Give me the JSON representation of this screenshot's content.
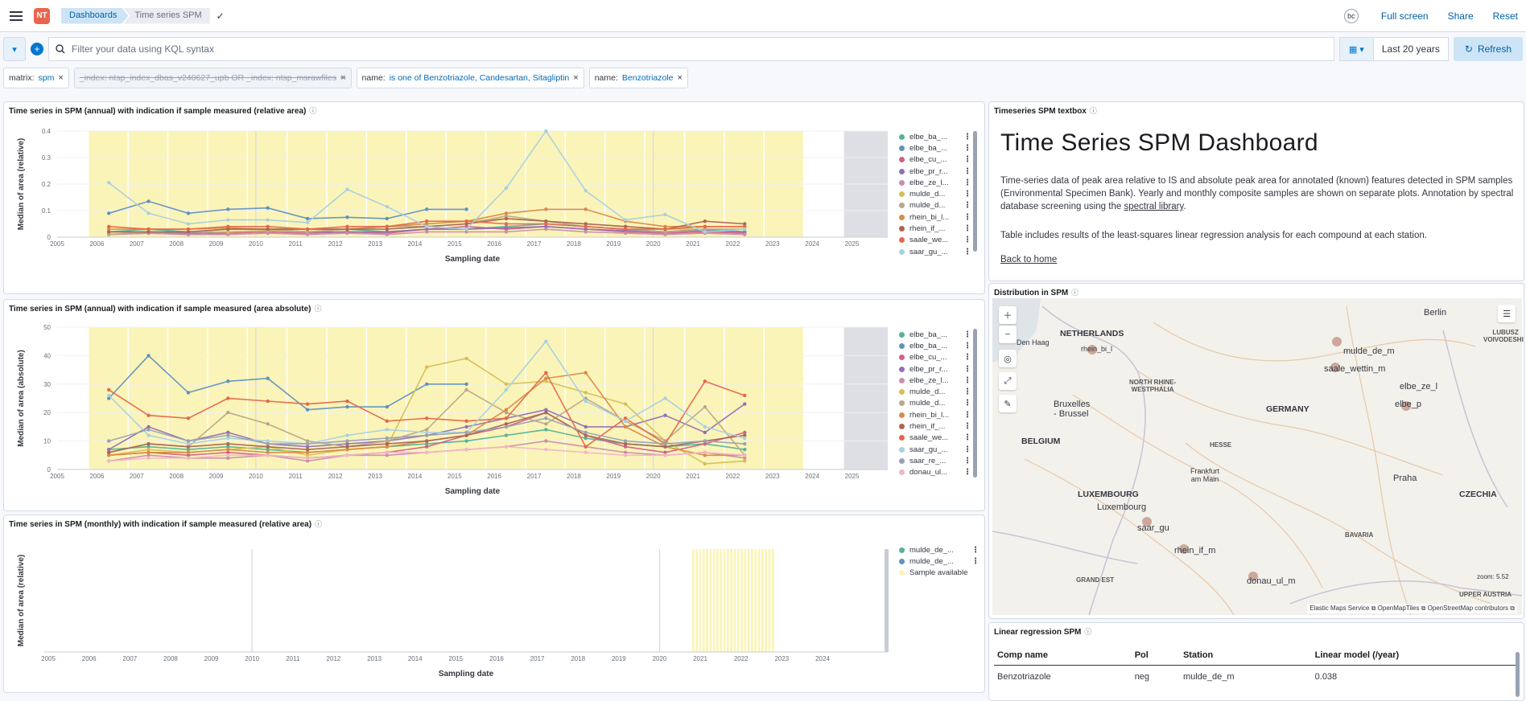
{
  "topbar": {
    "logo": "NT",
    "breadcrumb1": "Dashboards",
    "breadcrumb2": "Time series SPM",
    "avatar": "bc",
    "full_screen": "Full screen",
    "share": "Share",
    "reset": "Reset"
  },
  "query": {
    "placeholder": "Filter your data using KQL syntax",
    "time_range": "Last 20 years",
    "refresh": "Refresh"
  },
  "filters": [
    {
      "key": "matrix:",
      "value": "spm",
      "disabled": false
    },
    {
      "key": "_index: ntsp_index_dbas_v240627_upb OR _index: ntsp_msrawfiles",
      "value": "",
      "disabled": true
    },
    {
      "key": "name:",
      "value": "is one of Benzotriazole, Candesartan, Sitagliptin",
      "disabled": false
    },
    {
      "key": "name:",
      "value": "Benzotriazole",
      "disabled": false
    }
  ],
  "panel1": {
    "title": "Time series in SPM (annual) with indication if sample measured (relative area)",
    "legend": [
      "elbe_ba_...",
      "elbe_ba_...",
      "elbe_cu_...",
      "elbe_pr_r...",
      "elbe_ze_l...",
      "mulde_d...",
      "mulde_d...",
      "rhein_bi_l...",
      "rhein_if_...",
      "saale_we...",
      "saar_gu_..."
    ]
  },
  "panel2": {
    "title": "Time series in SPM (annual) with indication if sample measured (area absolute)",
    "legend": [
      "elbe_ba_...",
      "elbe_ba_...",
      "elbe_cu_...",
      "elbe_pr_r...",
      "elbe_ze_l...",
      "mulde_d...",
      "mulde_d...",
      "rhein_bi_l...",
      "rhein_if_...",
      "saale_we...",
      "saar_gu_...",
      "saar_re_...",
      "donau_ul..."
    ]
  },
  "panel3": {
    "title": "Time series in SPM (monthly) with indication if sample measured (relative area)",
    "legend": [
      "mulde_de_...",
      "mulde_de_...",
      "Sample available"
    ]
  },
  "textbox": {
    "title": "Timeseries SPM textbox",
    "heading": "Time Series SPM Dashboard",
    "p1a": "Time-series data of peak area relative to IS and absolute peak area for annotated (known) features detected in SPM samples (Environmental Specimen Bank). Yearly and monthly composite samples are shown on separate plots. Annotation by spectral database screening using the ",
    "p1link": "spectral library",
    "p1b": ".",
    "p2": "Table includes results of the least-squares linear regression analysis for each compound at each station.",
    "back": "Back to home"
  },
  "map": {
    "title": "Distribution in SPM",
    "zoom": "zoom: 5.52",
    "attribution": [
      "Elastic Maps Service",
      "OpenMapTiles",
      "OpenStreetMap contributors"
    ],
    "labels": {
      "netherlands": "NETHERLANDS",
      "denhaag": "Den Haag",
      "belgium": "BELGIUM",
      "bruxelles": "Bruxelles\n- Brussel",
      "luxembourg_c": "LUXEMBOURG",
      "luxembourg": "Luxembourg",
      "germany": "GERMANY",
      "nrw": "NORTH RHINE-\nWESTPHALIA",
      "hesse": "HESSE",
      "frankfurt": "Frankfurt\nam Main",
      "bavaria": "BAVARIA",
      "czechia": "CZECHIA",
      "praha": "Praha",
      "berlin": "Berlin",
      "lubusz": "LUBUSZ\nVOIVODESHIP",
      "upper_austria": "UPPER AUSTRIA",
      "grand_est": "GRAND EST"
    },
    "stations": [
      "rhein_bi_l",
      "mulde_de_m",
      "saale_wettin_m",
      "elbe_ze_l",
      "elbe_p",
      "saar_gu",
      "rhein_if_m",
      "donau_ul_m"
    ]
  },
  "regression": {
    "title": "Linear regression SPM",
    "headers": [
      "Comp name",
      "Pol",
      "Station",
      "Linear model (/year)"
    ],
    "rows": [
      [
        "Benzotriazole",
        "neg",
        "mulde_de_m",
        "0.038"
      ]
    ]
  },
  "chart_data": [
    {
      "type": "line",
      "title": "Time series in SPM (annual) with indication if sample measured (relative area)",
      "xlabel": "Sampling date",
      "ylabel": "Median of area (relative)",
      "xlim": [
        2005,
        2025.9
      ],
      "ylim": [
        0,
        0.4
      ],
      "x_ticks": [
        "2005",
        "2006",
        "2007",
        "2008",
        "2009",
        "2010",
        "2011",
        "2012",
        "2013",
        "2014",
        "2015",
        "2016",
        "2017",
        "2018",
        "2019",
        "2020",
        "2021",
        "2022",
        "2023",
        "2024",
        "2025"
      ],
      "y_ticks": [
        0,
        0.1,
        0.2,
        0.3,
        0.4
      ],
      "sample_available_range": [
        2005.8,
        2022.9
      ],
      "no_data_range": [
        2024.8,
        2025.9
      ],
      "x": [
        2006.3,
        2007.3,
        2008.3,
        2009.3,
        2010.3,
        2011.3,
        2012.3,
        2013.3,
        2014.3,
        2015.3,
        2016.3,
        2017.3,
        2018.3,
        2019.3,
        2020.3,
        2021.3,
        2022.3
      ],
      "series": [
        {
          "name": "elbe_ba_...",
          "color": "#54b399",
          "values": [
            0.02,
            0.03,
            0.02,
            0.03,
            0.03,
            0.02,
            0.03,
            0.02,
            0.03,
            0.03,
            0.04,
            0.05,
            0.04,
            0.03,
            0.02,
            0.03,
            0.02
          ]
        },
        {
          "name": "elbe_ba_...",
          "color": "#6092c0",
          "values": [
            0.09,
            0.135,
            0.09,
            0.105,
            0.11,
            0.07,
            0.075,
            0.07,
            0.105,
            0.105,
            null,
            null,
            null,
            null,
            null,
            null,
            null
          ]
        },
        {
          "name": "elbe_cu_...",
          "color": "#d36086",
          "values": [
            0.01,
            0.015,
            0.01,
            0.015,
            0.02,
            0.015,
            0.02,
            0.015,
            0.03,
            0.04,
            0.03,
            0.04,
            0.03,
            0.02,
            0.015,
            0.02,
            0.015
          ]
        },
        {
          "name": "elbe_pr_r...",
          "color": "#9170b8",
          "values": [
            0.02,
            0.02,
            0.015,
            0.02,
            0.025,
            0.02,
            0.02,
            0.02,
            0.03,
            0.03,
            0.035,
            0.04,
            0.03,
            0.025,
            0.02,
            0.025,
            0.02
          ]
        },
        {
          "name": "elbe_ze_l...",
          "color": "#ca8eae",
          "values": [
            0.01,
            0.015,
            0.01,
            0.01,
            0.015,
            0.01,
            0.015,
            0.01,
            0.02,
            0.02,
            0.02,
            0.03,
            0.02,
            0.015,
            0.01,
            0.015,
            0.01
          ]
        },
        {
          "name": "mulde_d...",
          "color": "#d6bf57",
          "values": [
            0.02,
            0.02,
            0.02,
            0.02,
            0.025,
            0.02,
            0.03,
            0.04,
            0.05,
            0.06,
            0.07,
            0.06,
            0.05,
            0.04,
            0.03,
            0.03,
            0.03
          ]
        },
        {
          "name": "mulde_d...",
          "color": "#b9a888",
          "values": [
            0.01,
            0.02,
            0.02,
            0.03,
            0.03,
            0.02,
            0.03,
            0.04,
            0.04,
            0.05,
            0.08,
            0.06,
            0.04,
            0.03,
            0.02,
            0.03,
            0.03
          ]
        },
        {
          "name": "rhein_bi_l...",
          "color": "#da8b45",
          "values": [
            0.03,
            0.03,
            0.03,
            0.035,
            0.03,
            0.03,
            0.03,
            0.04,
            0.05,
            0.06,
            0.09,
            0.105,
            0.105,
            0.06,
            0.04,
            0.04,
            0.04
          ]
        },
        {
          "name": "rhein_if_...",
          "color": "#aa6556",
          "values": [
            0.02,
            0.02,
            0.02,
            0.03,
            0.03,
            0.03,
            0.03,
            0.03,
            0.04,
            0.05,
            0.07,
            0.06,
            0.05,
            0.04,
            0.03,
            0.06,
            0.05
          ]
        },
        {
          "name": "saale_we...",
          "color": "#e7664c",
          "values": [
            0.04,
            0.03,
            0.03,
            0.04,
            0.04,
            0.03,
            0.04,
            0.04,
            0.06,
            0.06,
            0.05,
            0.05,
            0.04,
            0.03,
            0.03,
            0.04,
            0.04
          ]
        },
        {
          "name": "saar_gu_...",
          "color": "#a8d0e0",
          "values": [
            0.205,
            0.09,
            0.05,
            0.065,
            0.065,
            0.055,
            0.18,
            0.115,
            0.04,
            0.03,
            0.185,
            0.4,
            0.175,
            0.065,
            0.085,
            0.02,
            0.03
          ]
        }
      ]
    },
    {
      "type": "line",
      "title": "Time series in SPM (annual) with indication if sample measured (area absolute)",
      "xlabel": "Sampling date",
      "ylabel": "Median of area (absolute)",
      "xlim": [
        2005,
        2025.9
      ],
      "ylim": [
        0,
        50
      ],
      "x_ticks": [
        "2005",
        "2006",
        "2007",
        "2008",
        "2009",
        "2010",
        "2011",
        "2012",
        "2013",
        "2014",
        "2015",
        "2016",
        "2017",
        "2018",
        "2019",
        "2020",
        "2021",
        "2022",
        "2023",
        "2024",
        "2025"
      ],
      "y_ticks": [
        0,
        10,
        20,
        30,
        40,
        50
      ],
      "sample_available_range": [
        2005.8,
        2022.9
      ],
      "no_data_range": [
        2024.8,
        2025.9
      ],
      "x": [
        2006.3,
        2007.3,
        2008.3,
        2009.3,
        2010.3,
        2011.3,
        2012.3,
        2013.3,
        2014.3,
        2015.3,
        2016.3,
        2017.3,
        2018.3,
        2019.3,
        2020.3,
        2021.3,
        2022.3
      ],
      "series": [
        {
          "name": "elbe_ba_...",
          "color": "#54b399",
          "values": [
            7,
            8,
            7,
            8,
            7,
            6,
            7,
            8,
            9,
            10,
            12,
            14,
            11,
            9,
            8,
            9,
            7
          ]
        },
        {
          "name": "elbe_ba_...",
          "color": "#6092c0",
          "values": [
            25,
            40,
            27,
            31,
            32,
            21,
            22,
            22,
            30,
            30,
            null,
            null,
            null,
            null,
            null,
            null,
            null
          ]
        },
        {
          "name": "elbe_cu_...",
          "color": "#d36086",
          "values": [
            5,
            6,
            5,
            6,
            5,
            4,
            5,
            6,
            8,
            12,
            15,
            20,
            12,
            8,
            6,
            9,
            13
          ]
        },
        {
          "name": "elbe_pr_r...",
          "color": "#9170b8",
          "values": [
            7,
            15,
            10,
            13,
            9,
            8,
            9,
            10,
            12,
            15,
            18,
            21,
            15,
            15,
            19,
            13,
            23
          ]
        },
        {
          "name": "elbe_ze_l...",
          "color": "#ca8eae",
          "values": [
            3,
            5,
            4,
            4,
            5,
            3,
            5,
            5,
            6,
            7,
            8,
            10,
            8,
            6,
            5,
            6,
            4
          ]
        },
        {
          "name": "mulde_d...",
          "color": "#d6bf57",
          "values": [
            5,
            7,
            6,
            7,
            8,
            5,
            7,
            8,
            36,
            39,
            30,
            31,
            27,
            23,
            10,
            2,
            3
          ]
        },
        {
          "name": "mulde_d...",
          "color": "#b9a888",
          "values": [
            6,
            9,
            8,
            20,
            16,
            10,
            8,
            10,
            14,
            28,
            20,
            16,
            25,
            17,
            10,
            22,
            5
          ]
        },
        {
          "name": "rhein_bi_l...",
          "color": "#da8b45",
          "values": [
            5,
            6,
            6,
            7,
            6,
            6,
            7,
            8,
            10,
            12,
            21,
            32,
            34,
            15,
            8,
            5,
            5
          ]
        },
        {
          "name": "rhein_if_...",
          "color": "#aa6556",
          "values": [
            6,
            9,
            8,
            9,
            8,
            7,
            8,
            9,
            10,
            12,
            16,
            20,
            12,
            9,
            8,
            10,
            12
          ]
        },
        {
          "name": "saale_we...",
          "color": "#e7664c",
          "values": [
            28,
            19,
            18,
            25,
            24,
            23,
            24,
            17,
            18,
            17,
            18,
            34,
            8,
            18,
            9,
            31,
            26
          ]
        },
        {
          "name": "saar_gu_...",
          "color": "#a8d0e0",
          "values": [
            26,
            12,
            9,
            11,
            10,
            9,
            12,
            14,
            13,
            13,
            28,
            45,
            24,
            17,
            25,
            15,
            11
          ]
        },
        {
          "name": "saar_re_...",
          "color": "#98a2b3",
          "values": [
            10,
            14,
            10,
            12,
            9,
            9,
            10,
            11,
            12,
            13,
            15,
            18,
            13,
            10,
            9,
            10,
            9
          ]
        },
        {
          "name": "donau_ul...",
          "color": "#f1b6c9",
          "values": [
            3,
            4,
            4,
            5,
            5,
            4,
            5,
            6,
            6,
            7,
            8,
            7,
            6,
            5,
            5,
            6,
            5
          ]
        }
      ]
    },
    {
      "type": "line",
      "title": "Time series in SPM (monthly) with indication if sample measured (relative area)",
      "xlabel": "Sampling date",
      "ylabel": "Median of area (relative)",
      "xlim": [
        2004.9,
        2025.6
      ],
      "x_ticks": [
        "2005",
        "2006",
        "2007",
        "2008",
        "2009",
        "2010",
        "2011",
        "2012",
        "2013",
        "2014",
        "2015",
        "2016",
        "2017",
        "2018",
        "2019",
        "2020",
        "2021",
        "2022",
        "2023",
        "2024"
      ],
      "sample_available_range": [
        2020.8,
        2022.8
      ],
      "series": [
        {
          "name": "mulde_de_...",
          "color": "#54b399",
          "values": []
        },
        {
          "name": "mulde_de_...",
          "color": "#6092c0",
          "values": []
        }
      ]
    }
  ]
}
